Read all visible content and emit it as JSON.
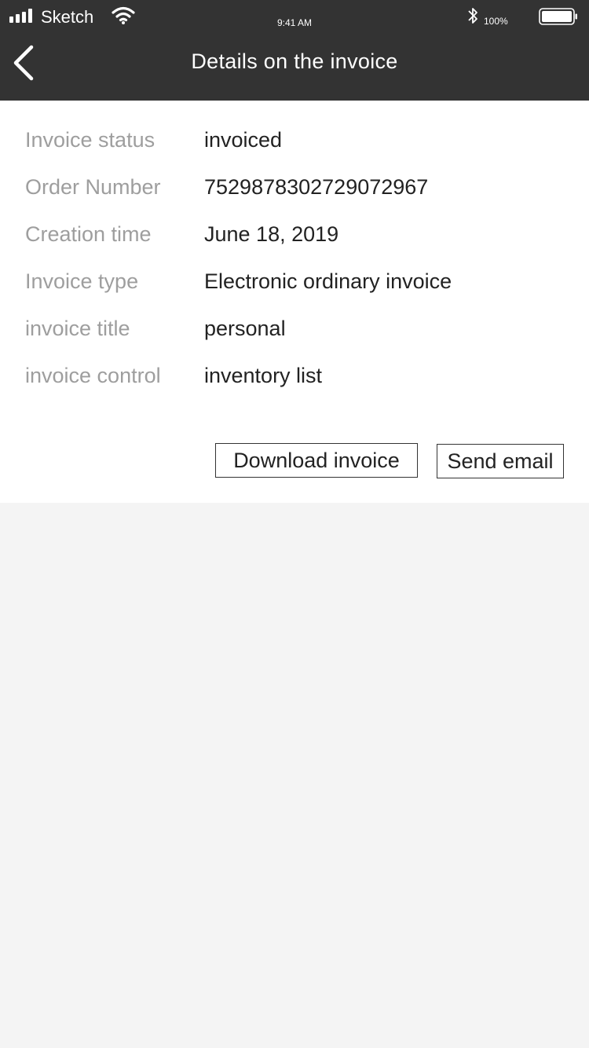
{
  "status_bar": {
    "carrier": "Sketch",
    "time": "9:41 AM",
    "battery_percent": "100%"
  },
  "nav": {
    "title": "Details on the invoice"
  },
  "details": [
    {
      "label": "Invoice status",
      "value": "invoiced"
    },
    {
      "label": "Order Number",
      "value": "7529878302729072967"
    },
    {
      "label": "Creation time",
      "value": "June 18, 2019"
    },
    {
      "label": "Invoice type",
      "value": "Electronic ordinary invoice"
    },
    {
      "label": "invoice title",
      "value": "personal"
    },
    {
      "label": "invoice control",
      "value": "inventory list"
    }
  ],
  "actions": {
    "download_label": "Download invoice",
    "email_label": "Send email"
  },
  "colors": {
    "header_bg": "#333333",
    "page_bg": "#f4f4f4",
    "label_text": "#9e9e9e",
    "value_text": "#222222"
  }
}
